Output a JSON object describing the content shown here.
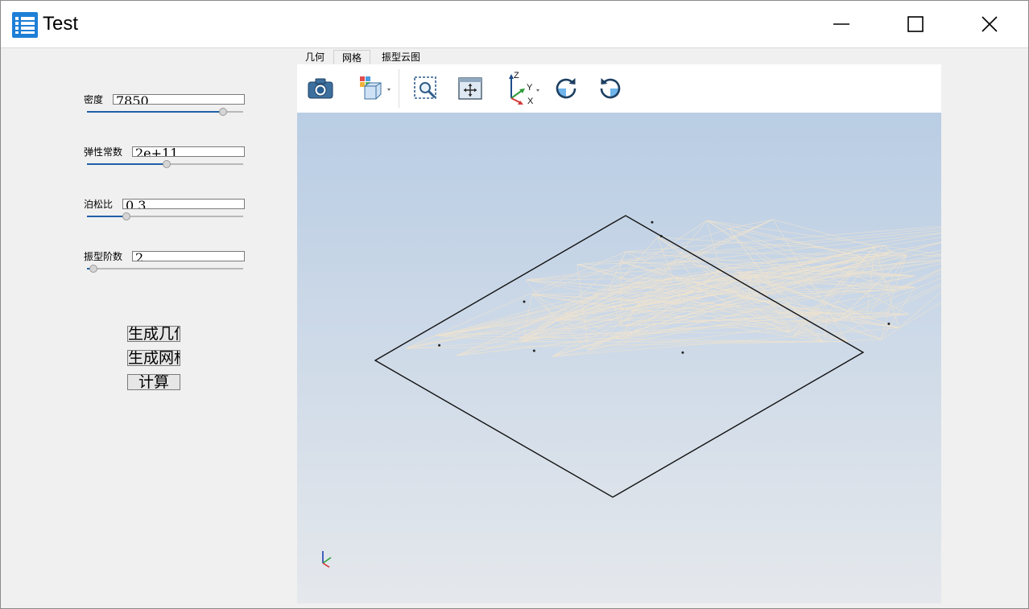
{
  "window": {
    "title": "Test",
    "controls": {
      "minimize": "minimize",
      "maximize": "maximize",
      "close": "close"
    }
  },
  "params": [
    {
      "label": "密度",
      "value": "7850",
      "slider": 0.87
    },
    {
      "label": "弹性常数",
      "value": "2e+11",
      "slider": 0.51
    },
    {
      "label": "泊松比",
      "value": "0.3",
      "slider": 0.25
    },
    {
      "label": "振型阶数",
      "value": "2",
      "slider": 0.04
    }
  ],
  "actions": {
    "geometry_label": "生成几何",
    "mesh_label": "生成网格",
    "compute_label": "计算"
  },
  "tabs": [
    "几何",
    "网格",
    "振型云图"
  ],
  "active_tab": 1,
  "toolbar": [
    {
      "icon": "camera-icon"
    },
    {
      "icon": "view-cube-icon"
    },
    {
      "icon": "zoom-window-icon"
    },
    {
      "icon": "fit-all-icon"
    },
    {
      "icon": "axes-orientation-icon",
      "labels": [
        "Z",
        "Y",
        "X"
      ]
    },
    {
      "icon": "rotate-cw-icon"
    },
    {
      "icon": "rotate-ccw-icon"
    }
  ],
  "colors": {
    "accent": "#1e5fa8",
    "viewport_top": "#b9cde4",
    "viewport_bottom": "#e5e8ec",
    "mesh": "#efe3cf"
  }
}
